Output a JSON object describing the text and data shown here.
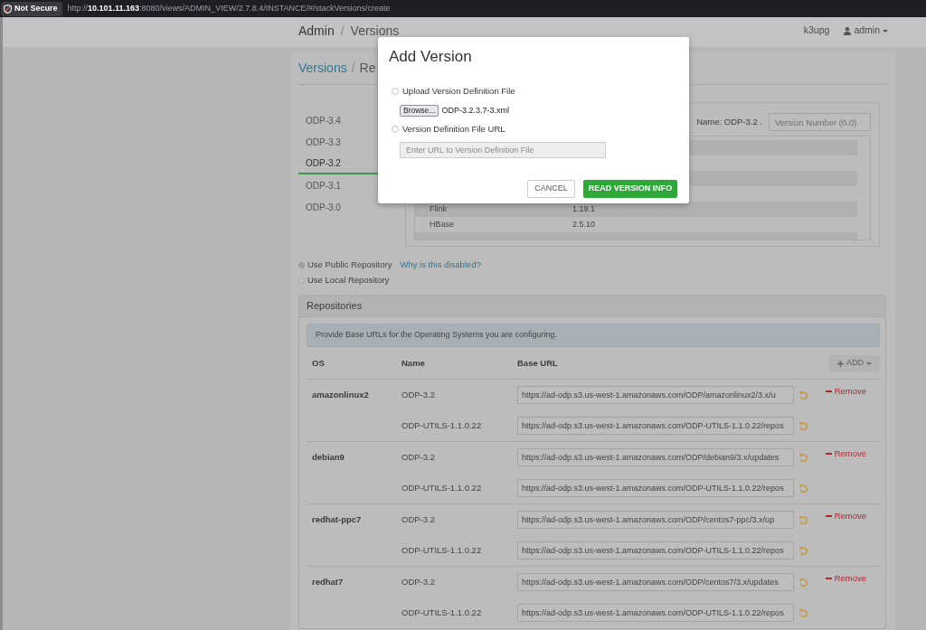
{
  "browser": {
    "security_label": "Not Secure",
    "url": "http://**10.101.11.163**:8080/views/ADMIN_VIEW/2.7.8.4/INSTANCE/#/stackVersions/create"
  },
  "header": {
    "breadcrumb": [
      "Admin",
      "Versions"
    ],
    "separator": "/",
    "cluster": "k3upg",
    "user": "admin"
  },
  "page": {
    "breadcrumb": [
      "Versions",
      "Re"
    ],
    "separator": "/"
  },
  "version_tabs": [
    {
      "label": "ODP-3.4",
      "selected": false
    },
    {
      "label": "ODP-3.3",
      "selected": false
    },
    {
      "label": "ODP-3.2",
      "selected": true
    },
    {
      "label": "ODP-3.1",
      "selected": false
    },
    {
      "label": "ODP-3.0",
      "selected": false
    }
  ],
  "version_details": {
    "name_label": "Name: ODP-3.2 .",
    "version_number": {
      "placeholder": "Version Number (0.0)"
    },
    "components": [
      {
        "name": "Flink",
        "version": "1.19.1"
      },
      {
        "name": "HBase",
        "version": "2.5.10"
      }
    ]
  },
  "repository_options": [
    {
      "label": "Use Public Repository",
      "selected": false,
      "disabled": true,
      "help_link": "Why is this disabled?"
    },
    {
      "label": "Use Local Repository",
      "selected": false,
      "disabled": false
    }
  ],
  "repositories": {
    "title": "Repositories",
    "notice": "Provide Base URLs for the Operating Systems you are configuring.",
    "columns": [
      "OS",
      "Name",
      "Base URL"
    ],
    "add_button": {
      "label": "ADD",
      "disabled": true
    },
    "os_groups": [
      {
        "os": "amazonlinux2",
        "remove": "Remove",
        "repos": [
          {
            "name": "ODP-3.2",
            "base_url": "https://ad-odp.s3.us-west-1.amazonaws.com/ODP/amazonlinux2/3.x/u"
          },
          {
            "name": "ODP-UTILS-1.1.0.22",
            "base_url": "https://ad-odp.s3.us-west-1.amazonaws.com/ODP-UTILS-1.1.0.22/repos"
          }
        ]
      },
      {
        "os": "debian9",
        "remove": "Remove",
        "repos": [
          {
            "name": "ODP-3.2",
            "base_url": "https://ad-odp.s3.us-west-1.amazonaws.com/ODP/debian9/3.x/updates"
          },
          {
            "name": "ODP-UTILS-1.1.0.22",
            "base_url": "https://ad-odp.s3.us-west-1.amazonaws.com/ODP-UTILS-1.1.0.22/repos"
          }
        ]
      },
      {
        "os": "redhat-ppc7",
        "remove": "Remove",
        "repos": [
          {
            "name": "ODP-3.2",
            "base_url": "https://ad-odp.s3.us-west-1.amazonaws.com/ODP/centos7-ppc/3.x/up"
          },
          {
            "name": "ODP-UTILS-1.1.0.22",
            "base_url": "https://ad-odp.s3.us-west-1.amazonaws.com/ODP-UTILS-1.1.0.22/repos"
          }
        ]
      },
      {
        "os": "redhat7",
        "remove": "Remove",
        "repos": [
          {
            "name": "ODP-3.2",
            "base_url": "https://ad-odp.s3.us-west-1.amazonaws.com/ODP/centos7/3.x/updates"
          },
          {
            "name": "ODP-UTILS-1.1.0.22",
            "base_url": "https://ad-odp.s3.us-west-1.amazonaws.com/ODP-UTILS-1.1.0.22/repos"
          }
        ]
      }
    ]
  },
  "dialog": {
    "title": "Add Version",
    "options": [
      {
        "kind": "file",
        "label": "Upload Version Definition File",
        "selected": false,
        "button": "Browse...",
        "file_name": "ODP-3.2.3.7-3.xml"
      },
      {
        "kind": "url",
        "label": "Version Definition File URL",
        "selected": false,
        "placeholder": "Enter URL to Version Definition File"
      }
    ],
    "buttons": [
      {
        "label": "CANCEL",
        "kind": "secondary"
      },
      {
        "label": "READ VERSION INFO",
        "kind": "primary"
      }
    ]
  }
}
